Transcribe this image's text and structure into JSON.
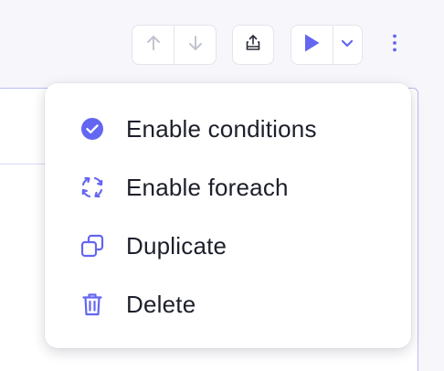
{
  "colors": {
    "accent": "#6366f1",
    "muted_icon": "#b6b8c4",
    "text": "#1d1f2b",
    "border": "#e3e4ee"
  },
  "toolbar": {
    "move_up_icon": "arrow-up-icon",
    "move_down_icon": "arrow-down-icon",
    "export_icon": "export-icon",
    "run_icon": "play-icon",
    "run_options_icon": "chevron-down-icon",
    "more_icon": "more-vertical-icon"
  },
  "menu": {
    "items": [
      {
        "label": "Enable conditions",
        "icon": "check-circle-icon"
      },
      {
        "label": "Enable foreach",
        "icon": "loop-icon"
      },
      {
        "label": "Duplicate",
        "icon": "duplicate-icon"
      },
      {
        "label": "Delete",
        "icon": "trash-icon"
      }
    ]
  }
}
